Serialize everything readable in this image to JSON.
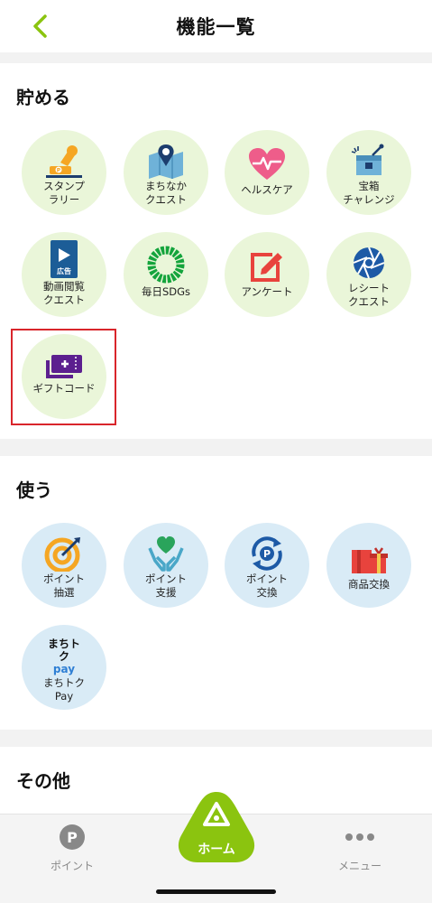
{
  "header": {
    "title": "機能一覧",
    "back_icon": "chevron-left-icon"
  },
  "sections": [
    {
      "title": "貯める",
      "items": [
        {
          "label": "スタンプ\nラリー",
          "icon": "stamp-icon"
        },
        {
          "label": "まちなか\nクエスト",
          "icon": "map-pin-icon"
        },
        {
          "label": "ヘルスケア",
          "icon": "heart-pulse-icon"
        },
        {
          "label": "宝箱\nチャレンジ",
          "icon": "treasure-box-icon"
        },
        {
          "label": "動画閲覧\nクエスト",
          "icon": "video-ad-icon",
          "badge": "広告"
        },
        {
          "label": "毎日SDGs",
          "icon": "sdgs-wheel-icon"
        },
        {
          "label": "アンケート",
          "icon": "edit-icon"
        },
        {
          "label": "レシート\nクエスト",
          "icon": "shutter-icon"
        },
        {
          "label": "ギフトコード",
          "icon": "gift-card-icon"
        }
      ]
    },
    {
      "title": "使う",
      "items": [
        {
          "label": "ポイント\n抽選",
          "icon": "target-icon"
        },
        {
          "label": "ポイント\n支援",
          "icon": "heart-hands-icon"
        },
        {
          "label": "ポイント\n交換",
          "icon": "exchange-icon"
        },
        {
          "label": "商品交換",
          "icon": "gift-box-icon"
        },
        {
          "label": "まちトク\nPay",
          "icon": "machitoku-pay-logo",
          "logo_text": "まちトク",
          "logo_sub": "pay"
        }
      ]
    },
    {
      "title": "その他"
    }
  ],
  "tabbar": {
    "point": {
      "label": "ポイント",
      "glyph": "P"
    },
    "home": {
      "label": "ホーム"
    },
    "menu": {
      "label": "メニュー"
    }
  },
  "colors": {
    "accent": "#8bc40f",
    "highlight": "#d9252b",
    "tile_green": "#eaf6d9",
    "tile_blue": "#d9ebf6"
  }
}
